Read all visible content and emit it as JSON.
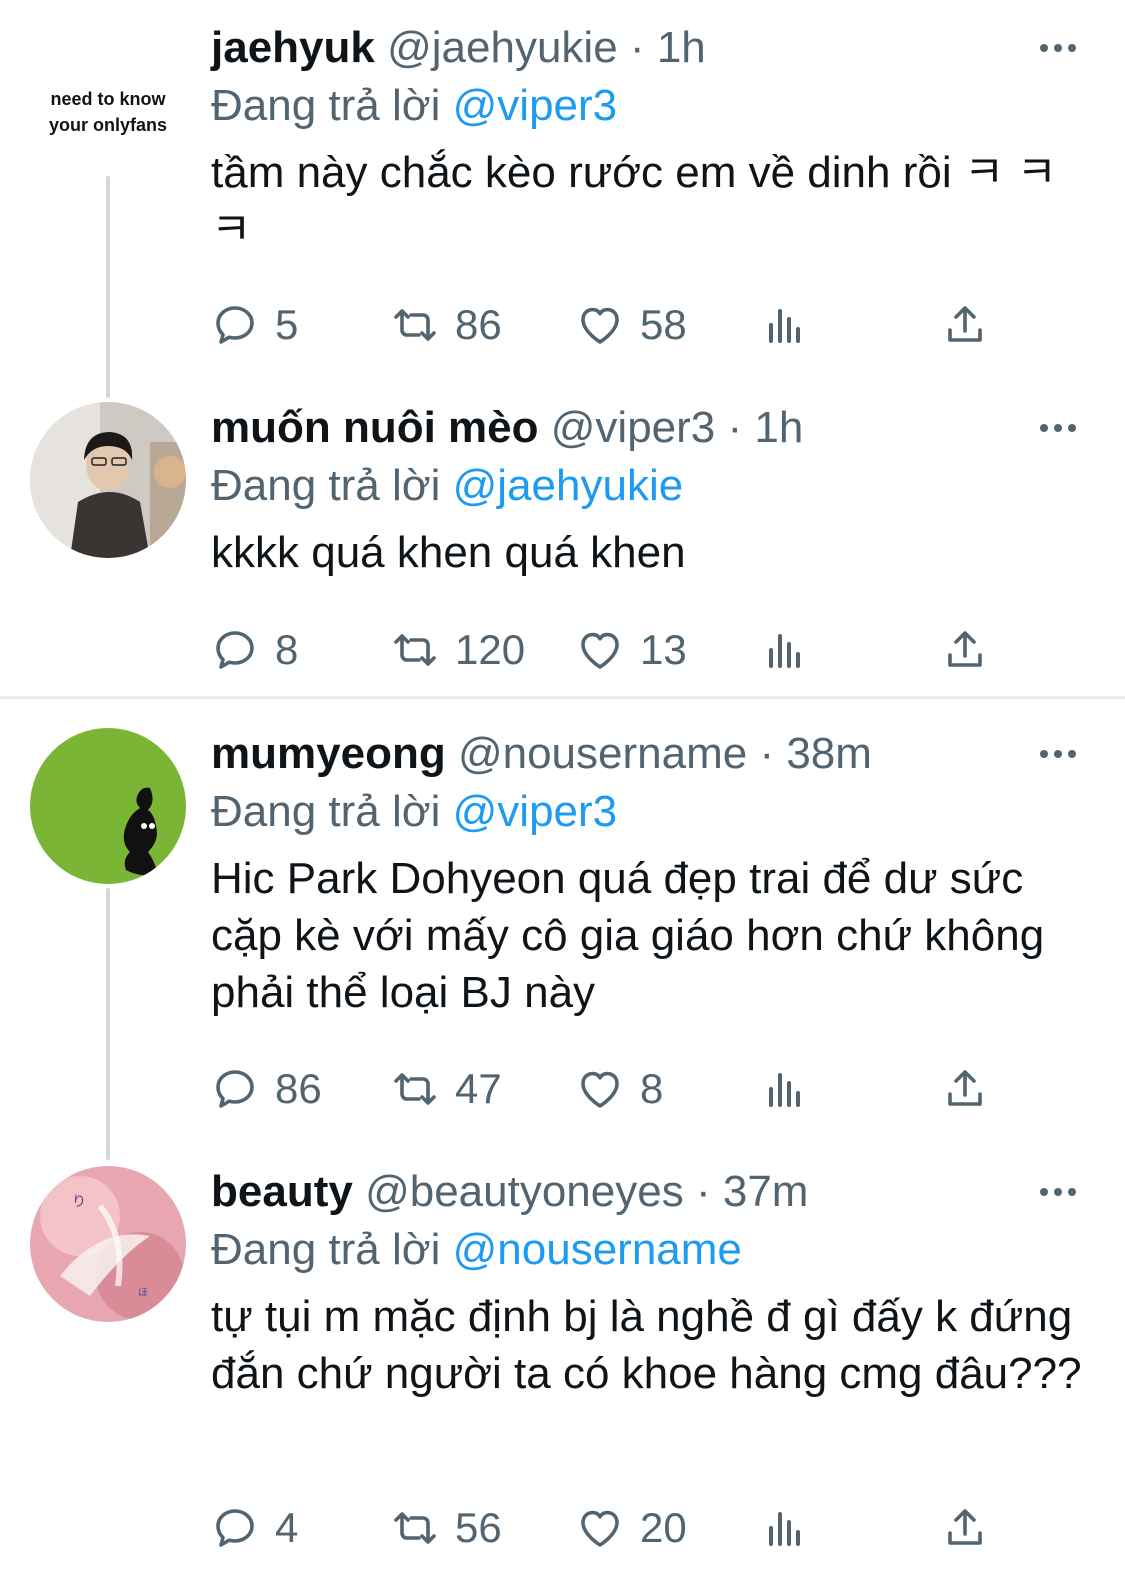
{
  "reply_prefix": "Đang trả lời",
  "tweets": [
    {
      "name": "jaehyuk",
      "handle": "@jaehyukie",
      "time": "1h",
      "sep": "·",
      "reply_to": "@viper3",
      "avatar_text": "need to know your onlyfans",
      "text": "tầm này chắc kèo rước em về dinh rồi ㅋ ㅋㅋ",
      "replies": "5",
      "retweets": "86",
      "likes": "58"
    },
    {
      "name": "muốn nuôi mèo",
      "handle": "@viper3",
      "time": "1h",
      "sep": "·",
      "reply_to": "@jaehyukie",
      "text": "kkkk quá khen quá khen",
      "replies": "8",
      "retweets": "120",
      "likes": "13"
    },
    {
      "name": "mumyeong",
      "handle": "@nousername",
      "time": "38m",
      "sep": "·",
      "reply_to": "@viper3",
      "text": "Hic Park Dohyeon quá đẹp trai để dư sức cặp kè với mấy cô gia giáo hơn chứ không phải thể loại BJ này",
      "replies": "86",
      "retweets": "47",
      "likes": "8"
    },
    {
      "name": "beauty",
      "handle": "@beautyoneyes",
      "time": "37m",
      "sep": "·",
      "reply_to": "@nousername",
      "text": "tự tụi m mặc định bj là nghề đ gì đấy k đứng đắn chứ người ta có khoe hàng cmg đâu???",
      "replies": "4",
      "retweets": "56",
      "likes": "20"
    }
  ],
  "icons": {
    "reply": "reply-icon",
    "retweet": "retweet-icon",
    "like": "heart-icon",
    "views": "views-icon",
    "share": "share-icon",
    "more": "more-icon"
  },
  "colors": {
    "link": "#1d9bf0",
    "secondary": "#536471",
    "text": "#0f1419"
  }
}
